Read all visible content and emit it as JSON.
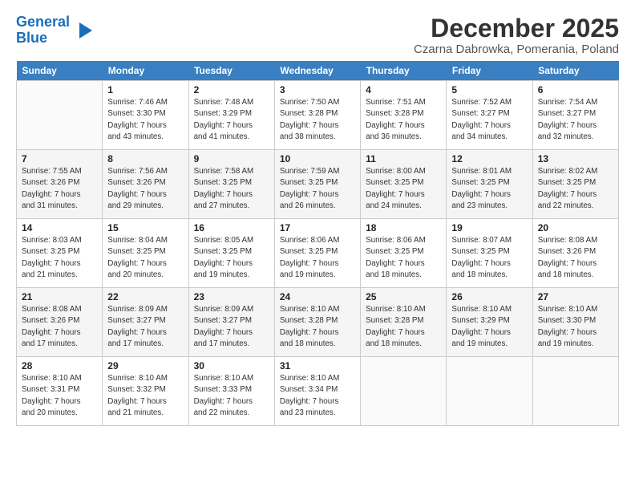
{
  "logo": {
    "line1": "General",
    "line2": "Blue"
  },
  "title": "December 2025",
  "location": "Czarna Dabrowka, Pomerania, Poland",
  "days_of_week": [
    "Sunday",
    "Monday",
    "Tuesday",
    "Wednesday",
    "Thursday",
    "Friday",
    "Saturday"
  ],
  "weeks": [
    [
      {
        "num": "",
        "info": ""
      },
      {
        "num": "1",
        "info": "Sunrise: 7:46 AM\nSunset: 3:30 PM\nDaylight: 7 hours\nand 43 minutes."
      },
      {
        "num": "2",
        "info": "Sunrise: 7:48 AM\nSunset: 3:29 PM\nDaylight: 7 hours\nand 41 minutes."
      },
      {
        "num": "3",
        "info": "Sunrise: 7:50 AM\nSunset: 3:28 PM\nDaylight: 7 hours\nand 38 minutes."
      },
      {
        "num": "4",
        "info": "Sunrise: 7:51 AM\nSunset: 3:28 PM\nDaylight: 7 hours\nand 36 minutes."
      },
      {
        "num": "5",
        "info": "Sunrise: 7:52 AM\nSunset: 3:27 PM\nDaylight: 7 hours\nand 34 minutes."
      },
      {
        "num": "6",
        "info": "Sunrise: 7:54 AM\nSunset: 3:27 PM\nDaylight: 7 hours\nand 32 minutes."
      }
    ],
    [
      {
        "num": "7",
        "info": "Sunrise: 7:55 AM\nSunset: 3:26 PM\nDaylight: 7 hours\nand 31 minutes."
      },
      {
        "num": "8",
        "info": "Sunrise: 7:56 AM\nSunset: 3:26 PM\nDaylight: 7 hours\nand 29 minutes."
      },
      {
        "num": "9",
        "info": "Sunrise: 7:58 AM\nSunset: 3:25 PM\nDaylight: 7 hours\nand 27 minutes."
      },
      {
        "num": "10",
        "info": "Sunrise: 7:59 AM\nSunset: 3:25 PM\nDaylight: 7 hours\nand 26 minutes."
      },
      {
        "num": "11",
        "info": "Sunrise: 8:00 AM\nSunset: 3:25 PM\nDaylight: 7 hours\nand 24 minutes."
      },
      {
        "num": "12",
        "info": "Sunrise: 8:01 AM\nSunset: 3:25 PM\nDaylight: 7 hours\nand 23 minutes."
      },
      {
        "num": "13",
        "info": "Sunrise: 8:02 AM\nSunset: 3:25 PM\nDaylight: 7 hours\nand 22 minutes."
      }
    ],
    [
      {
        "num": "14",
        "info": "Sunrise: 8:03 AM\nSunset: 3:25 PM\nDaylight: 7 hours\nand 21 minutes."
      },
      {
        "num": "15",
        "info": "Sunrise: 8:04 AM\nSunset: 3:25 PM\nDaylight: 7 hours\nand 20 minutes."
      },
      {
        "num": "16",
        "info": "Sunrise: 8:05 AM\nSunset: 3:25 PM\nDaylight: 7 hours\nand 19 minutes."
      },
      {
        "num": "17",
        "info": "Sunrise: 8:06 AM\nSunset: 3:25 PM\nDaylight: 7 hours\nand 19 minutes."
      },
      {
        "num": "18",
        "info": "Sunrise: 8:06 AM\nSunset: 3:25 PM\nDaylight: 7 hours\nand 18 minutes."
      },
      {
        "num": "19",
        "info": "Sunrise: 8:07 AM\nSunset: 3:25 PM\nDaylight: 7 hours\nand 18 minutes."
      },
      {
        "num": "20",
        "info": "Sunrise: 8:08 AM\nSunset: 3:26 PM\nDaylight: 7 hours\nand 18 minutes."
      }
    ],
    [
      {
        "num": "21",
        "info": "Sunrise: 8:08 AM\nSunset: 3:26 PM\nDaylight: 7 hours\nand 17 minutes."
      },
      {
        "num": "22",
        "info": "Sunrise: 8:09 AM\nSunset: 3:27 PM\nDaylight: 7 hours\nand 17 minutes."
      },
      {
        "num": "23",
        "info": "Sunrise: 8:09 AM\nSunset: 3:27 PM\nDaylight: 7 hours\nand 17 minutes."
      },
      {
        "num": "24",
        "info": "Sunrise: 8:10 AM\nSunset: 3:28 PM\nDaylight: 7 hours\nand 18 minutes."
      },
      {
        "num": "25",
        "info": "Sunrise: 8:10 AM\nSunset: 3:28 PM\nDaylight: 7 hours\nand 18 minutes."
      },
      {
        "num": "26",
        "info": "Sunrise: 8:10 AM\nSunset: 3:29 PM\nDaylight: 7 hours\nand 19 minutes."
      },
      {
        "num": "27",
        "info": "Sunrise: 8:10 AM\nSunset: 3:30 PM\nDaylight: 7 hours\nand 19 minutes."
      }
    ],
    [
      {
        "num": "28",
        "info": "Sunrise: 8:10 AM\nSunset: 3:31 PM\nDaylight: 7 hours\nand 20 minutes."
      },
      {
        "num": "29",
        "info": "Sunrise: 8:10 AM\nSunset: 3:32 PM\nDaylight: 7 hours\nand 21 minutes."
      },
      {
        "num": "30",
        "info": "Sunrise: 8:10 AM\nSunset: 3:33 PM\nDaylight: 7 hours\nand 22 minutes."
      },
      {
        "num": "31",
        "info": "Sunrise: 8:10 AM\nSunset: 3:34 PM\nDaylight: 7 hours\nand 23 minutes."
      },
      {
        "num": "",
        "info": ""
      },
      {
        "num": "",
        "info": ""
      },
      {
        "num": "",
        "info": ""
      }
    ]
  ]
}
